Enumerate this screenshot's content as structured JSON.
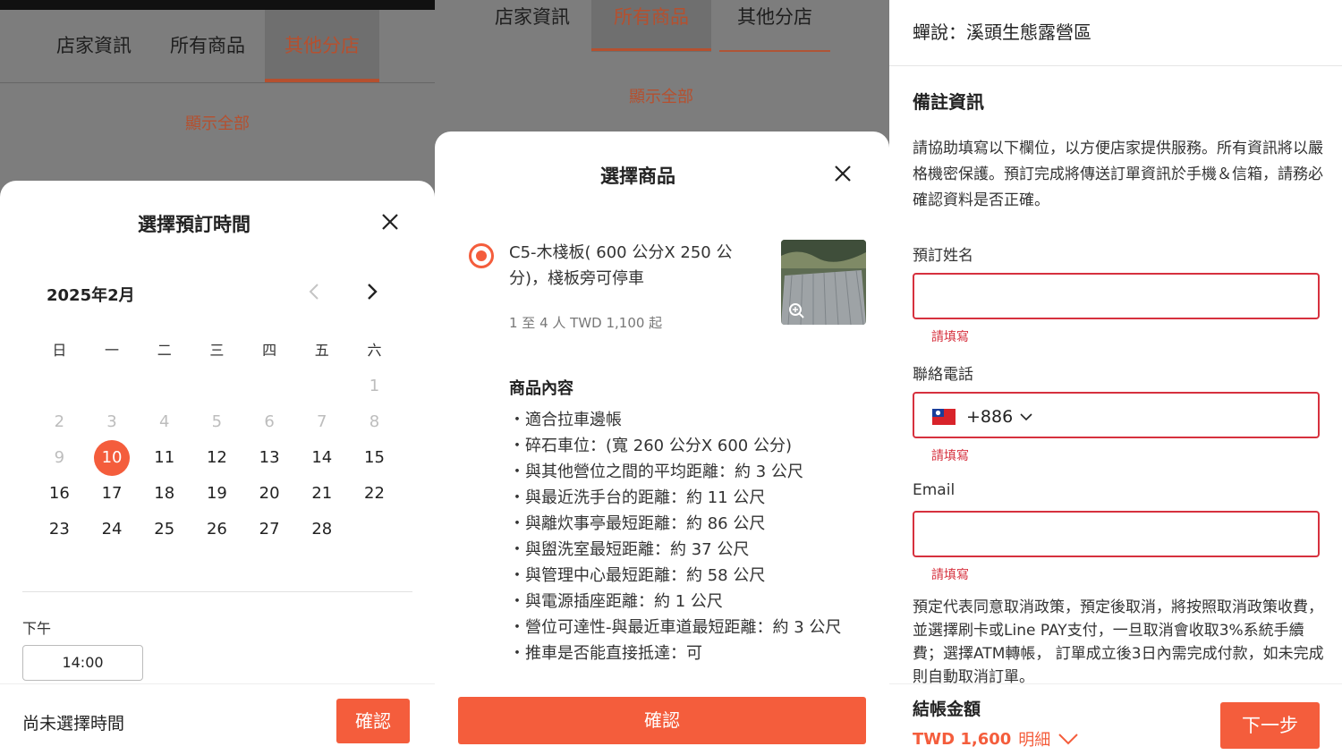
{
  "panel1": {
    "tabs": [
      "店家資訊",
      "所有商品",
      "其他分店"
    ],
    "active_tab": "其他分店",
    "show_all": "顯示全部",
    "sheet_title": "選擇預訂時間",
    "month_label": "2025年2月",
    "weekdays": [
      "日",
      "一",
      "二",
      "三",
      "四",
      "五",
      "六"
    ],
    "weeks": [
      [
        "",
        "",
        "",
        "",
        "",
        "",
        "1"
      ],
      [
        "2",
        "3",
        "4",
        "5",
        "6",
        "7",
        "8"
      ],
      [
        "9",
        "10",
        "11",
        "12",
        "13",
        "14",
        "15"
      ],
      [
        "16",
        "17",
        "18",
        "19",
        "20",
        "21",
        "22"
      ],
      [
        "23",
        "24",
        "25",
        "26",
        "27",
        "28",
        ""
      ]
    ],
    "disabled_days": [
      "1",
      "2",
      "3",
      "4",
      "5",
      "6",
      "7",
      "8",
      "9"
    ],
    "selected_day": "10",
    "period_label": "下午",
    "time_chip": "14:00",
    "status_text": "尚未選擇時間",
    "confirm_label": "確認"
  },
  "panel2": {
    "tabs": [
      "店家資訊",
      "所有商品",
      "其他分店"
    ],
    "active_tab": "所有商品",
    "show_all": "顯示全部",
    "sheet_title": "選擇商品",
    "product_name": "C5-木棧板( 600 公分X 250 公分)，棧板旁可停車",
    "product_meta": "1 至 4 人   TWD 1,100 起",
    "content_title": "商品內容",
    "features": [
      "・適合拉車邊帳",
      "・碎石車位：(寬 260 公分X 600 公分)",
      "・與其他營位之間的平均距離：約 3 公尺",
      "・與最近洗手台的距離：約 11 公尺",
      "・與離炊事亭最短距離：約 86 公尺",
      "・與盥洗室最短距離：約 37 公尺",
      "・與管理中心最短距離：約 58 公尺",
      "・與電源插座距離：約 1 公尺",
      "・營位可達性-與最近車道最短距離：約 3 公尺",
      "・推車是否能直接抵達：可"
    ],
    "confirm_label": "確認"
  },
  "panel3": {
    "header_title": "蟬說：溪頭生態露營區",
    "section_title": "備註資訊",
    "description": "請協助填寫以下欄位，以方便店家提供服務。所有資訊將以嚴格機密保護。預訂完成將傳送訂單資訊於手機＆信箱，請務必確認資料是否正確。",
    "name_label": "預訂姓名",
    "phone_label": "聯絡電話",
    "email_label": "Email",
    "required_error": "請填寫",
    "country_code": "+886",
    "policy": "預定代表同意取消政策，預定後取消，將按照取消政策收費，並選擇刷卡或Line PAY支付，一旦取消會收取3%系統手續費；選擇ATM轉帳， 訂單成立後3日內需完成付款，如未完成則自動取消訂單。",
    "total_label": "結帳金額",
    "total_value": "TWD 1,600",
    "detail_label": "明細",
    "next_label": "下一步"
  },
  "colors": {
    "accent": "#f45d3c",
    "tab_active": "#b5502f",
    "error": "#d6313e",
    "overlay": "#7d7d7d"
  }
}
